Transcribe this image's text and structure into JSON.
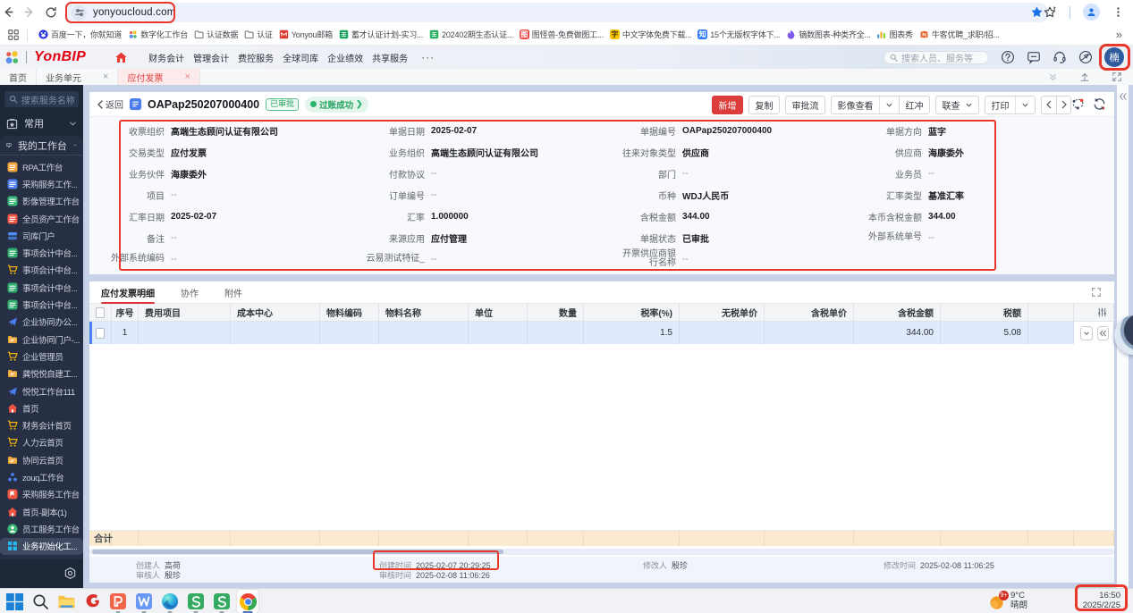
{
  "browser": {
    "url": "yonyoucloud.com",
    "bookmarks": [
      {
        "label": "百度一下，你就知道",
        "icon": "paw",
        "color": "#2932e1"
      },
      {
        "label": "数字化工作台",
        "icon": "dots4",
        "color": "#e8453c"
      },
      {
        "label": "认证数据",
        "icon": "folder-outline",
        "color": "#5f6368"
      },
      {
        "label": "认证",
        "icon": "folder-outline",
        "color": "#5f6368"
      },
      {
        "label": "Yonyou邮箱",
        "icon": "mail",
        "color": "#e03a2f"
      },
      {
        "label": "蓄才认证计划-实习...",
        "icon": "sheet",
        "color": "#1ea362"
      },
      {
        "label": "202402期生态认证...",
        "icon": "sheet",
        "color": "#28b060"
      },
      {
        "label": "图怪兽-免费做图工...",
        "icon": "sqchar",
        "color": "#ef4b4b",
        "glyph": "图"
      },
      {
        "label": "中文字体免费下载...",
        "icon": "sqchar",
        "color": "#f7c600",
        "glyph": "字",
        "tcolor": "#4a3a00"
      },
      {
        "label": "15个无版权字体下...",
        "icon": "sqchar",
        "color": "#2f7bf5",
        "glyph": "知"
      },
      {
        "label": "镝数图表-种类齐全...",
        "icon": "flame",
        "color": "#7b5bf0"
      },
      {
        "label": "图表秀",
        "icon": "barchart",
        "color": "#ff9d2e"
      },
      {
        "label": "牛客优聘_求职/招...",
        "icon": "nowcoder",
        "color": "#e8642c"
      }
    ],
    "overflow": "»"
  },
  "app_header": {
    "brand": "YonBIP",
    "nav": [
      {
        "label": "财务会计"
      },
      {
        "label": "管理会计"
      },
      {
        "label": "费控服务"
      },
      {
        "label": "全球司库"
      },
      {
        "label": "企业绩效"
      },
      {
        "label": "共享服务"
      }
    ],
    "more": "···",
    "search_placeholder": "搜索人员、服务等",
    "avatar": "楠"
  },
  "page_tabs": [
    {
      "label": "首页"
    },
    {
      "label": "业务单元",
      "closable": true
    },
    {
      "label": "应付发票",
      "closable": true,
      "active": true
    }
  ],
  "sidebar": {
    "search_placeholder": "搜索服务名称",
    "favorites_label": "常用",
    "group_label": "我的工作台",
    "items": [
      {
        "label": "RPA工作台",
        "icon": "sq",
        "color": "#f2a33a"
      },
      {
        "label": "采购服务工作...",
        "icon": "sq",
        "color": "#4e7df2"
      },
      {
        "label": "影像管理工作台",
        "icon": "sq",
        "color": "#3bb877"
      },
      {
        "label": "全员资产工作台",
        "icon": "sq",
        "color": "#f05542"
      },
      {
        "label": "司库门户",
        "icon": "layers",
        "color": "#4e8df5"
      },
      {
        "label": "事项会计中台...",
        "icon": "sq",
        "color": "#2fae6e"
      },
      {
        "label": "事项会计中台...",
        "icon": "cart",
        "color": "#f7b500"
      },
      {
        "label": "事项会计中台...",
        "icon": "sq",
        "color": "#2fae6e"
      },
      {
        "label": "事项会计中台...",
        "icon": "sq",
        "color": "#2fae6e"
      },
      {
        "label": "企业协同办公...",
        "icon": "bird",
        "color": "#4a7df0"
      },
      {
        "label": "企业协同门户-...",
        "icon": "folder",
        "color": "#f2a93b"
      },
      {
        "label": "企业管理员",
        "icon": "cart",
        "color": "#f7b500"
      },
      {
        "label": "龚悦悦自建工...",
        "icon": "folder",
        "color": "#f2a93b"
      },
      {
        "label": "悦悦工作台111",
        "icon": "bird",
        "color": "#4a7df0"
      },
      {
        "label": "首页",
        "icon": "home",
        "color": "#f05542"
      },
      {
        "label": "财务会计首页",
        "icon": "cart",
        "color": "#f7b500"
      },
      {
        "label": "人力云首页",
        "icon": "cart",
        "color": "#f7b500"
      },
      {
        "label": "协同云首页",
        "icon": "folder",
        "color": "#f2a93b"
      },
      {
        "label": "zouq工作台",
        "icon": "dots3",
        "color": "#4a7df0"
      },
      {
        "label": "采购服务工作台",
        "icon": "flag",
        "color": "#f05542"
      },
      {
        "label": "首页-副本(1)",
        "icon": "home",
        "color": "#f05542"
      },
      {
        "label": "员工服务工作台",
        "icon": "person",
        "color": "#3bb877"
      },
      {
        "label": "业务初始化工...",
        "icon": "grid4",
        "color": "#29b6f0",
        "hovered": true
      }
    ]
  },
  "doc": {
    "back_label": "返回",
    "title": "OAPap250207000400",
    "approve_badge": "已审批",
    "post_badge": "过账成功",
    "toolbar": [
      {
        "label": "新增",
        "style": "primary"
      },
      {
        "label": "复制"
      },
      {
        "label": "审批流"
      },
      {
        "label": "影像查看",
        "caret": true,
        "joined": true
      },
      {
        "label": "红冲"
      },
      {
        "label": "联查",
        "inline_caret": true
      },
      {
        "label": "打印",
        "caret": true
      }
    ],
    "fields": {
      "col1": [
        {
          "label": "收票组织",
          "value": "高端生态顾问认证有限公司"
        },
        {
          "label": "交易类型",
          "value": "应付发票"
        },
        {
          "label": "业务伙伴",
          "value": "海康委外"
        },
        {
          "label": "项目",
          "value": "--"
        },
        {
          "label": "汇率日期",
          "value": "2025-02-07"
        },
        {
          "label": "备注",
          "value": "--"
        },
        {
          "label": "外部系统编码",
          "value": "--"
        }
      ],
      "col2": [
        {
          "label": "单据日期",
          "value": "2025-02-07"
        },
        {
          "label": "业务组织",
          "value": "高端生态顾问认证有限公司"
        },
        {
          "label": "付款协议",
          "value": "--"
        },
        {
          "label": "订单编号",
          "value": "--"
        },
        {
          "label": "汇率",
          "value": "1.000000"
        },
        {
          "label": "来源应用",
          "value": "应付管理"
        },
        {
          "label": "云易测试特征_",
          "value": "--"
        }
      ],
      "col3": [
        {
          "label": "单据编号",
          "value": "OAPap250207000400"
        },
        {
          "label": "往来对象类型",
          "value": "供应商"
        },
        {
          "label": "部门",
          "value": "--"
        },
        {
          "label": "币种",
          "value": "WDJ人民币"
        },
        {
          "label": "含税金额",
          "value": "344.00"
        },
        {
          "label": "单据状态",
          "value": "已审批"
        },
        {
          "label": "开票供应商银行名称",
          "value": "--"
        }
      ],
      "col4": [
        {
          "label": "单据方向",
          "value": "蓝字"
        },
        {
          "label": "供应商",
          "value": "海康委外"
        },
        {
          "label": "业务员",
          "value": "--"
        },
        {
          "label": "汇率类型",
          "value": "基准汇率"
        },
        {
          "label": "本币含税金额",
          "value": "344.00"
        },
        {
          "label": "外部系统单号",
          "value": "--"
        }
      ]
    },
    "detail_tabs": [
      {
        "label": "应付发票明细",
        "active": true
      },
      {
        "label": "协作"
      },
      {
        "label": "附件"
      }
    ],
    "table": {
      "columns": [
        {
          "label": "",
          "type": "checkbox"
        },
        {
          "label": "序号",
          "align": "center"
        },
        {
          "label": "费用项目"
        },
        {
          "label": "成本中心"
        },
        {
          "label": "物料编码"
        },
        {
          "label": "物料名称"
        },
        {
          "label": "单位"
        },
        {
          "label": "数量",
          "align": "right"
        },
        {
          "label": "税率(%)",
          "align": "right"
        },
        {
          "label": "无税单价",
          "align": "right"
        },
        {
          "label": "含税单价",
          "align": "right"
        },
        {
          "label": "含税金额",
          "align": "right"
        },
        {
          "label": "税额",
          "align": "right"
        },
        {
          "label": ""
        },
        {
          "label": "",
          "type": "settings"
        }
      ],
      "rows": [
        {
          "cells": [
            "",
            "1",
            "",
            "",
            "",
            "",
            "",
            "",
            "1.5",
            "",
            "",
            "344.00",
            "5.08",
            "",
            ""
          ],
          "selected": true
        }
      ],
      "sum_label": "合计"
    },
    "footer": {
      "creator_label": "创建人",
      "creator": "高荷",
      "auditor_label": "审核人",
      "auditor": "殷珍",
      "created_label": "创建时间",
      "created": "2025-02-07 20:29:25",
      "audited_label": "审核时间",
      "audited": "2025-02-08 11:06:26",
      "modifier_label": "修改人",
      "modifier": "殷珍",
      "modified_label": "修改时间",
      "modified": "2025-02-08 11:06:25"
    }
  },
  "taskbar": {
    "icons": [
      {
        "name": "windows"
      },
      {
        "name": "search"
      },
      {
        "name": "explorer"
      },
      {
        "name": "letter-g"
      },
      {
        "name": "wps-p",
        "running": true
      },
      {
        "name": "wps-w",
        "running": true
      },
      {
        "name": "edge",
        "running": true
      },
      {
        "name": "wps-s",
        "running": true
      },
      {
        "name": "wps-s",
        "running": true
      },
      {
        "name": "chrome",
        "active": true
      }
    ],
    "weather": {
      "temp": "9°C",
      "cond": "晴朗",
      "badge": "9+"
    },
    "clock": {
      "time": "16:50",
      "date": "2025/2/25"
    }
  },
  "colors": {
    "brand_red": "#e60012",
    "accent_red": "#dd3c3c",
    "annotation_red": "#e8372b",
    "status_green": "#27a15f",
    "selected_row_blue": "#dfeafd",
    "sidebar_bg": "#1d2737"
  },
  "annotations": [
    "url-box",
    "avatar-box",
    "form-box",
    "created-time-box",
    "clock-box"
  ]
}
